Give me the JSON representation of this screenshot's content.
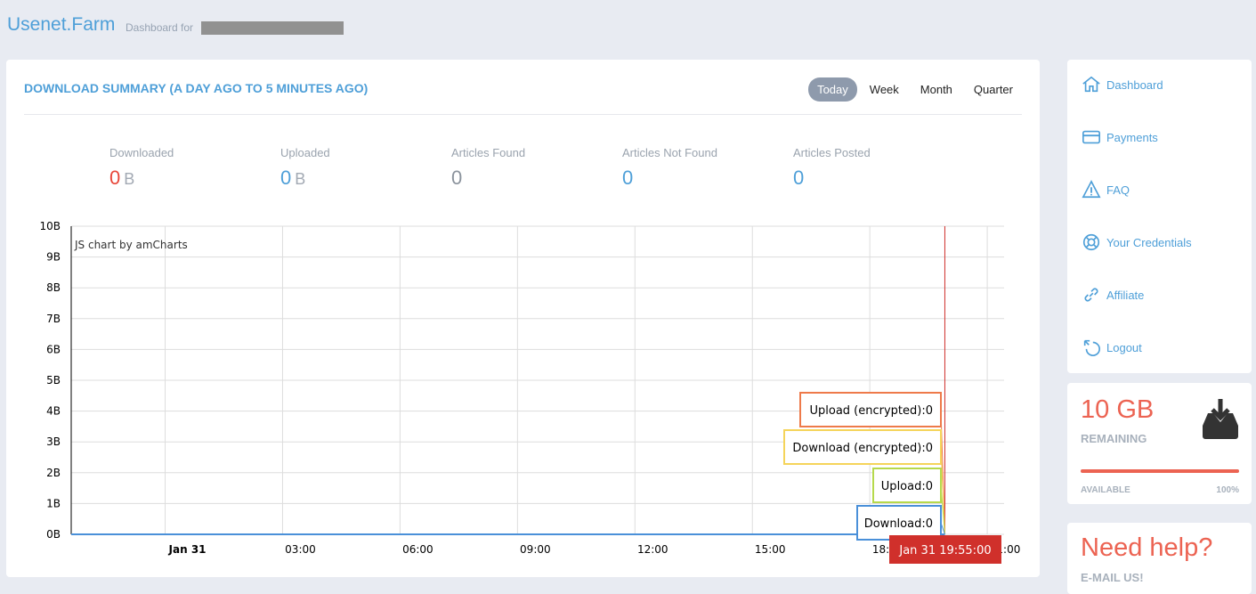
{
  "header": {
    "brand": "Usenet.Farm",
    "subtitle": "Dashboard for"
  },
  "summary": {
    "title": "DOWNLOAD SUMMARY (A DAY AGO TO 5 MINUTES AGO)",
    "tabs": [
      {
        "label": "Today",
        "active": true
      },
      {
        "label": "Week"
      },
      {
        "label": "Month"
      },
      {
        "label": "Quarter"
      }
    ],
    "stats": [
      {
        "label": "Downloaded",
        "value": "0",
        "unit": "B",
        "color": "#e8473a"
      },
      {
        "label": "Uploaded",
        "value": "0",
        "unit": "B",
        "color": "#4e9fd8"
      },
      {
        "label": "Articles Found",
        "value": "0",
        "unit": "",
        "color": "#8b939d"
      },
      {
        "label": "Articles Not Found",
        "value": "0",
        "unit": "",
        "color": "#4e9fd8"
      },
      {
        "label": "Articles Posted",
        "value": "0",
        "unit": "",
        "color": "#4e9fd8"
      }
    ]
  },
  "chart_data": {
    "type": "line",
    "credit": "JS chart by amCharts",
    "y_ticks": [
      "0B",
      "1B",
      "2B",
      "3B",
      "4B",
      "5B",
      "6B",
      "7B",
      "8B",
      "9B",
      "10B"
    ],
    "ylim": [
      0,
      10
    ],
    "x_ticks": [
      "Jan 31",
      "03:00",
      "06:00",
      "09:00",
      "12:00",
      "15:00",
      "18:00",
      "21:00"
    ],
    "xlim_hours": [
      -2.4,
      21.43
    ],
    "grid": true,
    "cursor": {
      "label": "Jan 31 19:55:00",
      "hour": 19.9167,
      "color": "#d0302b"
    },
    "series": [
      {
        "name": "Upload (encrypted)",
        "value": 0,
        "color": "#ee7a4a"
      },
      {
        "name": "Download (encrypted)",
        "value": 0,
        "color": "#f5d45a"
      },
      {
        "name": "Upload",
        "value": 0,
        "color": "#b6d94c"
      },
      {
        "name": "Download",
        "value": 0,
        "color": "#4a90d9"
      }
    ]
  },
  "sidebar": {
    "items": [
      {
        "label": "Dashboard",
        "icon": "home-icon"
      },
      {
        "label": "Payments",
        "icon": "credit-card-icon"
      },
      {
        "label": "FAQ",
        "icon": "info-icon"
      },
      {
        "label": "Your Credentials",
        "icon": "lifebuoy-icon"
      },
      {
        "label": "Affiliate",
        "icon": "link-icon"
      },
      {
        "label": "Logout",
        "icon": "logout-icon"
      }
    ]
  },
  "remaining": {
    "amount": "10 GB",
    "label": "REMAINING",
    "available_label": "AVAILABLE",
    "percent_label": "100%",
    "percent": 100
  },
  "help": {
    "title": "Need help?",
    "email": "E-MAIL US!"
  }
}
